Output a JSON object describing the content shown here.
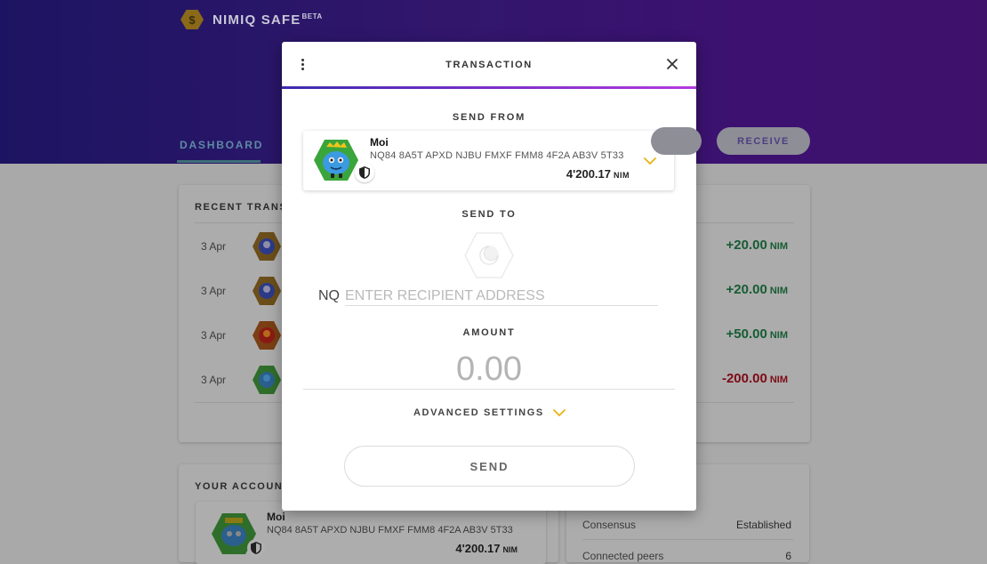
{
  "app": {
    "name": "NIMIQ SAFE",
    "badge": "BETA"
  },
  "nav": {
    "dashboard_label": "DASHBOARD",
    "receive_label": "RECEIVE"
  },
  "recent_transactions": {
    "title": "RECENT TRANS",
    "rows": [
      {
        "date": "3 Apr",
        "amount": "+20.00",
        "unit": "NIM",
        "direction": "in"
      },
      {
        "date": "3 Apr",
        "amount": "+20.00",
        "unit": "NIM",
        "direction": "in"
      },
      {
        "date": "3 Apr",
        "amount": "+50.00",
        "unit": "NIM",
        "direction": "in"
      },
      {
        "date": "3 Apr",
        "amount": "-200.00",
        "unit": "NIM",
        "direction": "out"
      }
    ]
  },
  "your_accounts": {
    "title": "YOUR ACCOUN",
    "account": {
      "name": "Moi",
      "address": "NQ84 8A5T APXD NJBU FMXF FMM8 4F2A AB3V 5T33",
      "balance": "4'200.17",
      "unit": "NIM"
    }
  },
  "network": {
    "consensus_label": "Consensus",
    "consensus_value": "Established",
    "peers_label": "Connected peers",
    "peers_value": "6"
  },
  "modal": {
    "title": "TRANSACTION",
    "send_from_label": "SEND FROM",
    "from_account": {
      "name": "Moi",
      "address": "NQ84 8A5T APXD NJBU FMXF FMM8 4F2A AB3V 5T33",
      "balance": "4'200.17",
      "unit": "NIM"
    },
    "send_to_label": "SEND TO",
    "recipient_prefix": "NQ",
    "recipient_value": "",
    "recipient_placeholder": "ENTER RECIPIENT ADDRESS",
    "amount_label": "AMOUNT",
    "amount_value": "0.00",
    "advanced_label": "ADVANCED SETTINGS",
    "send_label": "SEND"
  },
  "colors": {
    "accent": "#e9b213",
    "positive": "#165c33",
    "negative": "#7d0a14",
    "header_gradient_start": "#2b1f92",
    "header_gradient_end": "#5e1aa0"
  }
}
